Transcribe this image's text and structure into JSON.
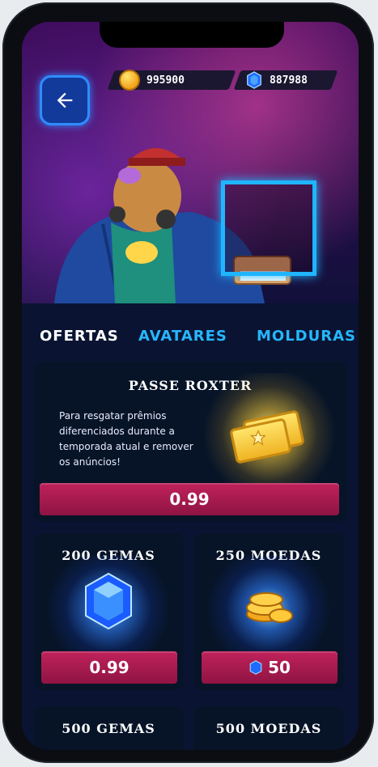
{
  "header": {
    "coins": "995900",
    "gems": "887988"
  },
  "tabs": [
    {
      "label": "OFERTAS",
      "active": true
    },
    {
      "label": "AVATARES",
      "active": false
    },
    {
      "label": "MOLDURAS",
      "active": false
    }
  ],
  "pass_offer": {
    "title": "PASSE ROXTER",
    "description": "Para resgatar prêmios diferenciados durante a temporada atual e remover os anúncios!",
    "price": "0.99"
  },
  "offers": [
    {
      "title": "200 GEMAS",
      "price": "0.99",
      "icon": "gem-icon"
    },
    {
      "title": "250 MOEDAS",
      "price": "50",
      "icon": "coin-stack-icon"
    }
  ],
  "more_offers": [
    {
      "title": "500 GEMAS"
    },
    {
      "title": "500 MOEDAS"
    }
  ],
  "colors": {
    "accent": "#27b6ff",
    "price_button": "#b01a52",
    "background": "#0a1432"
  }
}
